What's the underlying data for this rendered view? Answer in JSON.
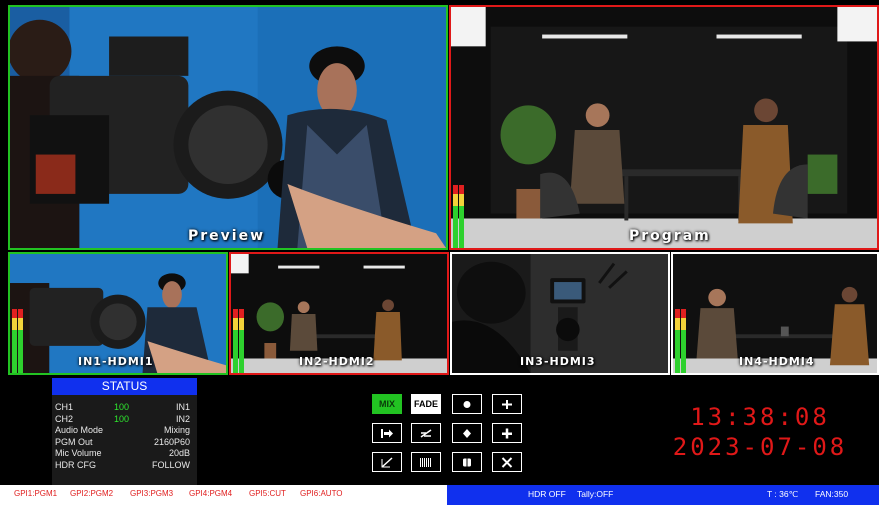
{
  "views": {
    "preview": {
      "label": "Preview"
    },
    "program": {
      "label": "Program"
    },
    "inputs": [
      {
        "label": "IN1-HDMI1"
      },
      {
        "label": "IN2-HDMI2"
      },
      {
        "label": "IN3-HDMI3"
      },
      {
        "label": "IN4-HDMI4"
      }
    ]
  },
  "status": {
    "title": "STATUS",
    "rows": [
      {
        "name": "CH1",
        "mid": "100",
        "value": "IN1"
      },
      {
        "name": "CH2",
        "mid": "100",
        "value": "IN2"
      },
      {
        "name": "Audio Mode",
        "mid": "",
        "value": "Mixing"
      },
      {
        "name": "PGM Out",
        "mid": "",
        "value": "2160P60"
      },
      {
        "name": "Mic Volume",
        "mid": "",
        "value": "20dB"
      },
      {
        "name": "HDR CFG",
        "mid": "",
        "value": "FOLLOW"
      }
    ]
  },
  "controls": {
    "mix": "MIX",
    "fade": "FADE",
    "icons": [
      "circle-wipe-icon",
      "cross-wipe-icon",
      "push-right-icon",
      "slide-left-icon",
      "diamond-wipe-icon",
      "plus-wipe-icon",
      "diagonal-wipe-icon",
      "blinds-icon",
      "square-wipe-icon",
      "x-wipe-icon"
    ]
  },
  "clock": {
    "time": "13:38:08",
    "date": "2023-07-08"
  },
  "gpi": [
    "GPI1:PGM1",
    "GPI2:PGM2",
    "GPI3:PGM3",
    "GPI4:PGM4",
    "GPI5:CUT",
    "GPI6:AUTO"
  ],
  "bottom_bar": {
    "hdr": "HDR OFF",
    "tally": "Tally:OFF",
    "temp": "T : 36℃",
    "fan": "FAN:350"
  },
  "colors": {
    "preview_border": "#22c322",
    "program_border": "#e01818",
    "status_blue": "#1030ee",
    "clock_red": "#e01818"
  }
}
